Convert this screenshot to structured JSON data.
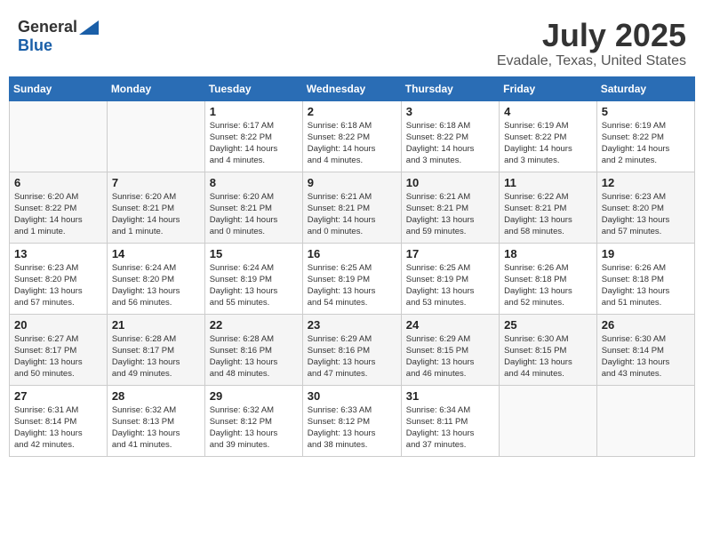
{
  "header": {
    "logo_general": "General",
    "logo_blue": "Blue",
    "month_year": "July 2025",
    "location": "Evadale, Texas, United States"
  },
  "weekdays": [
    "Sunday",
    "Monday",
    "Tuesday",
    "Wednesday",
    "Thursday",
    "Friday",
    "Saturday"
  ],
  "weeks": [
    [
      {
        "day": "",
        "detail": ""
      },
      {
        "day": "",
        "detail": ""
      },
      {
        "day": "1",
        "detail": "Sunrise: 6:17 AM\nSunset: 8:22 PM\nDaylight: 14 hours\nand 4 minutes."
      },
      {
        "day": "2",
        "detail": "Sunrise: 6:18 AM\nSunset: 8:22 PM\nDaylight: 14 hours\nand 4 minutes."
      },
      {
        "day": "3",
        "detail": "Sunrise: 6:18 AM\nSunset: 8:22 PM\nDaylight: 14 hours\nand 3 minutes."
      },
      {
        "day": "4",
        "detail": "Sunrise: 6:19 AM\nSunset: 8:22 PM\nDaylight: 14 hours\nand 3 minutes."
      },
      {
        "day": "5",
        "detail": "Sunrise: 6:19 AM\nSunset: 8:22 PM\nDaylight: 14 hours\nand 2 minutes."
      }
    ],
    [
      {
        "day": "6",
        "detail": "Sunrise: 6:20 AM\nSunset: 8:22 PM\nDaylight: 14 hours\nand 1 minute."
      },
      {
        "day": "7",
        "detail": "Sunrise: 6:20 AM\nSunset: 8:21 PM\nDaylight: 14 hours\nand 1 minute."
      },
      {
        "day": "8",
        "detail": "Sunrise: 6:20 AM\nSunset: 8:21 PM\nDaylight: 14 hours\nand 0 minutes."
      },
      {
        "day": "9",
        "detail": "Sunrise: 6:21 AM\nSunset: 8:21 PM\nDaylight: 14 hours\nand 0 minutes."
      },
      {
        "day": "10",
        "detail": "Sunrise: 6:21 AM\nSunset: 8:21 PM\nDaylight: 13 hours\nand 59 minutes."
      },
      {
        "day": "11",
        "detail": "Sunrise: 6:22 AM\nSunset: 8:21 PM\nDaylight: 13 hours\nand 58 minutes."
      },
      {
        "day": "12",
        "detail": "Sunrise: 6:23 AM\nSunset: 8:20 PM\nDaylight: 13 hours\nand 57 minutes."
      }
    ],
    [
      {
        "day": "13",
        "detail": "Sunrise: 6:23 AM\nSunset: 8:20 PM\nDaylight: 13 hours\nand 57 minutes."
      },
      {
        "day": "14",
        "detail": "Sunrise: 6:24 AM\nSunset: 8:20 PM\nDaylight: 13 hours\nand 56 minutes."
      },
      {
        "day": "15",
        "detail": "Sunrise: 6:24 AM\nSunset: 8:19 PM\nDaylight: 13 hours\nand 55 minutes."
      },
      {
        "day": "16",
        "detail": "Sunrise: 6:25 AM\nSunset: 8:19 PM\nDaylight: 13 hours\nand 54 minutes."
      },
      {
        "day": "17",
        "detail": "Sunrise: 6:25 AM\nSunset: 8:19 PM\nDaylight: 13 hours\nand 53 minutes."
      },
      {
        "day": "18",
        "detail": "Sunrise: 6:26 AM\nSunset: 8:18 PM\nDaylight: 13 hours\nand 52 minutes."
      },
      {
        "day": "19",
        "detail": "Sunrise: 6:26 AM\nSunset: 8:18 PM\nDaylight: 13 hours\nand 51 minutes."
      }
    ],
    [
      {
        "day": "20",
        "detail": "Sunrise: 6:27 AM\nSunset: 8:17 PM\nDaylight: 13 hours\nand 50 minutes."
      },
      {
        "day": "21",
        "detail": "Sunrise: 6:28 AM\nSunset: 8:17 PM\nDaylight: 13 hours\nand 49 minutes."
      },
      {
        "day": "22",
        "detail": "Sunrise: 6:28 AM\nSunset: 8:16 PM\nDaylight: 13 hours\nand 48 minutes."
      },
      {
        "day": "23",
        "detail": "Sunrise: 6:29 AM\nSunset: 8:16 PM\nDaylight: 13 hours\nand 47 minutes."
      },
      {
        "day": "24",
        "detail": "Sunrise: 6:29 AM\nSunset: 8:15 PM\nDaylight: 13 hours\nand 46 minutes."
      },
      {
        "day": "25",
        "detail": "Sunrise: 6:30 AM\nSunset: 8:15 PM\nDaylight: 13 hours\nand 44 minutes."
      },
      {
        "day": "26",
        "detail": "Sunrise: 6:30 AM\nSunset: 8:14 PM\nDaylight: 13 hours\nand 43 minutes."
      }
    ],
    [
      {
        "day": "27",
        "detail": "Sunrise: 6:31 AM\nSunset: 8:14 PM\nDaylight: 13 hours\nand 42 minutes."
      },
      {
        "day": "28",
        "detail": "Sunrise: 6:32 AM\nSunset: 8:13 PM\nDaylight: 13 hours\nand 41 minutes."
      },
      {
        "day": "29",
        "detail": "Sunrise: 6:32 AM\nSunset: 8:12 PM\nDaylight: 13 hours\nand 39 minutes."
      },
      {
        "day": "30",
        "detail": "Sunrise: 6:33 AM\nSunset: 8:12 PM\nDaylight: 13 hours\nand 38 minutes."
      },
      {
        "day": "31",
        "detail": "Sunrise: 6:34 AM\nSunset: 8:11 PM\nDaylight: 13 hours\nand 37 minutes."
      },
      {
        "day": "",
        "detail": ""
      },
      {
        "day": "",
        "detail": ""
      }
    ]
  ]
}
